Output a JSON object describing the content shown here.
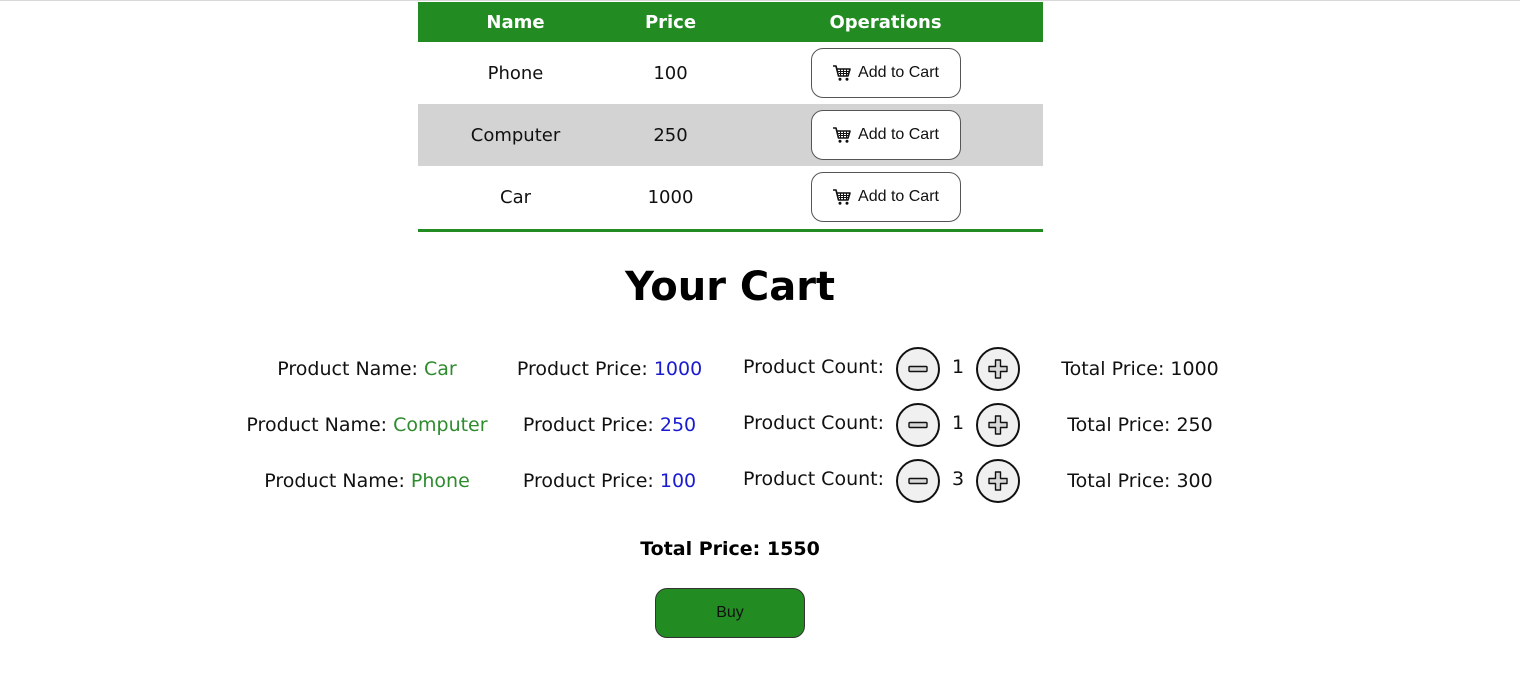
{
  "colors": {
    "accent_green": "#228b22",
    "alt_row_gray": "#d3d3d3",
    "name_green": "#2e8b2e",
    "price_blue": "#1a1ad0"
  },
  "product_table": {
    "headers": [
      "Name",
      "Price",
      "Operations"
    ],
    "rows": [
      {
        "name": "Phone",
        "price": "100",
        "action_label": "Add to Cart",
        "action_icon": "cart-icon"
      },
      {
        "name": "Computer",
        "price": "250",
        "action_label": "Add to Cart",
        "action_icon": "cart-icon"
      },
      {
        "name": "Car",
        "price": "1000",
        "action_label": "Add to Cart",
        "action_icon": "cart-icon"
      }
    ]
  },
  "cart": {
    "title": "Your Cart",
    "labels": {
      "product_name": "Product Name: ",
      "product_price": "Product Price: ",
      "product_count": "Product Count:",
      "total_price": "Total Price: "
    },
    "items": [
      {
        "name": "Car",
        "price": "1000",
        "count": "1",
        "total": "1000"
      },
      {
        "name": "Computer",
        "price": "250",
        "count": "1",
        "total": "250"
      },
      {
        "name": "Phone",
        "price": "100",
        "count": "3",
        "total": "300"
      }
    ],
    "grand_total_label": "Total Price: ",
    "grand_total_value": "1550",
    "buy_label": "Buy"
  }
}
